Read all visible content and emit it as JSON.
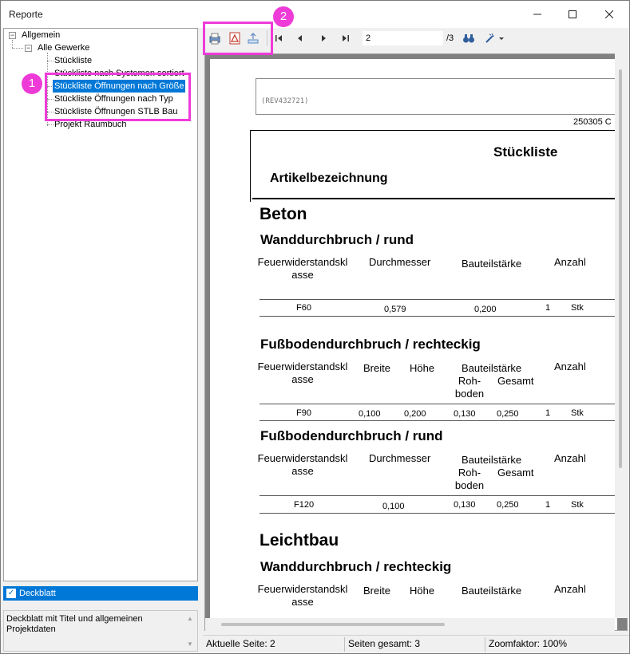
{
  "window": {
    "title": "Reporte"
  },
  "tree": {
    "root": "Allgemein",
    "group": "Alle Gewerke",
    "items": [
      "Stückliste",
      "Stückliste nach Systemen sortiert",
      "Stückliste Öffnungen nach Größe",
      "Stückliste Öffnungen nach Typ",
      "Stückliste Öffnungen STLB Bau",
      "Projekt Raumbuch"
    ]
  },
  "deck": {
    "label": "Deckblatt",
    "description": "Deckblatt mit Titel und allgemeinen Projektdaten"
  },
  "toolbar": {
    "page_value": "2",
    "page_total": "/3"
  },
  "document": {
    "rev": "(REV432721)",
    "date_code": "250305 C",
    "title": "Stückliste",
    "article_header": "Artikelbezeichnung",
    "sections": [
      {
        "group": "Beton",
        "name": "Wanddurchbruch / rund"
      },
      {
        "name": "Fußbodendurchbruch / rechteckig"
      },
      {
        "name": "Fußbodendurchbruch / rund"
      },
      {
        "group": "Leichtbau",
        "name": "Wanddurchbruch / rechteckig"
      }
    ],
    "cols": {
      "fw": "Feuerwiderstandskl asse",
      "durchmesser": "Durchmesser",
      "bauteil": "Bauteilstärke",
      "anzahl": "Anzahl",
      "breite": "Breite",
      "hoehe": "Höhe",
      "roh": "Roh- boden",
      "gesamt": "Gesamt"
    },
    "rows": [
      {
        "fw": "F60",
        "a": "0,579",
        "b": "0,200",
        "n": "1",
        "u": "Stk"
      },
      {
        "fw": "F90",
        "a": "0,100",
        "h": "0,200",
        "r": "0,130",
        "g": "0,250",
        "n": "1",
        "u": "Stk"
      },
      {
        "fw": "F120",
        "a": "0,100",
        "r": "0,130",
        "g": "0,250",
        "n": "1",
        "u": "Stk"
      }
    ]
  },
  "status": {
    "current": "Aktuelle Seite: 2",
    "total": "Seiten gesamt: 3",
    "zoom": "Zoomfaktor: 100%"
  },
  "annotations": {
    "one": "1",
    "two": "2"
  },
  "colors": {
    "accent": "#ee3bd8",
    "selection": "#0078d7"
  }
}
